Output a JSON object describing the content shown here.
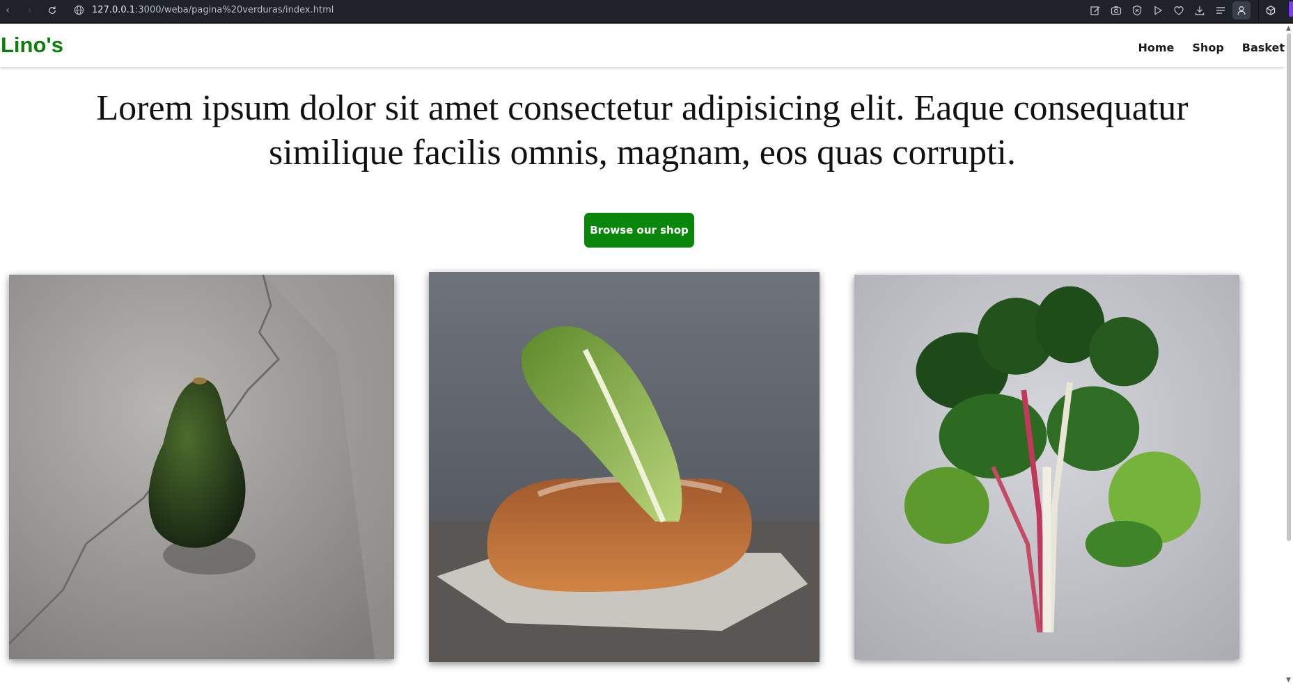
{
  "browser": {
    "url_host": "127.0.0.1",
    "url_path": ":3000/weba/pagina%20verduras/index.html",
    "toolbar_icons": [
      "edit-icon",
      "camera-icon",
      "shield-icon",
      "play-icon",
      "heart-icon",
      "download-icon",
      "menu-icon",
      "profile-icon",
      "extensions-icon"
    ]
  },
  "site": {
    "logo": "Lino's",
    "brand_color": "#0a7f0a",
    "nav": [
      {
        "label": "Home"
      },
      {
        "label": "Shop"
      },
      {
        "label": "Basket"
      }
    ]
  },
  "hero": {
    "title": "Lorem ipsum dolor sit amet consectetur adipisicing elit. Eaque consequatur similique facilis omnis, magnam, eos quas corrupti.",
    "cta_label": "Browse our shop",
    "cta_color": "#0a870a"
  },
  "gallery": {
    "images": [
      {
        "subject": "avocado on concrete wall"
      },
      {
        "subject": "bread loaf with lettuce leaf"
      },
      {
        "subject": "bunch of swiss chard"
      }
    ]
  }
}
